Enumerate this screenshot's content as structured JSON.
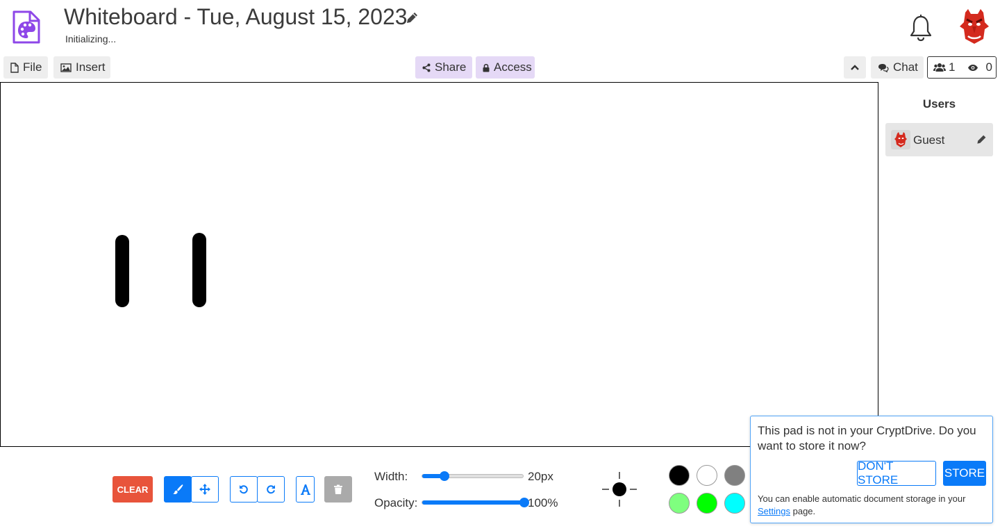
{
  "header": {
    "title": "Whiteboard - Tue, August 15, 2023",
    "status": "Initializing..."
  },
  "toolbar": {
    "file_label": "File",
    "insert_label": "Insert",
    "share_label": "Share",
    "access_label": "Access",
    "chat_label": "Chat",
    "users_count": "1",
    "viewers_count": "0"
  },
  "users_panel": {
    "heading": "Users",
    "users": [
      {
        "name": "Guest"
      }
    ]
  },
  "tools": {
    "clear_label": "CLEAR",
    "width_label": "Width:",
    "width_value": "20px",
    "width_fraction": 0.22,
    "opacity_label": "Opacity:",
    "opacity_value": "100%",
    "opacity_fraction": 1.0,
    "brush_color": "#000000"
  },
  "palette": [
    "#000000",
    "#ffffff",
    "#808080",
    "#f0eee9",
    "#f7e9e9",
    "#f7f0f0",
    "#f8f3e6",
    "#7fff7f",
    "#00ff00",
    "#00ffff"
  ],
  "colors": {
    "accent": "#0a7af8",
    "clear": "#e8543b",
    "share_bg": "#e5d9f6",
    "app_icon": "#8e47e8"
  },
  "store_popup": {
    "question": "This pad is not in your CryptDrive. Do you want to store it now?",
    "dont_store_label": "DON'T STORE",
    "store_label": "STORE",
    "note_before": "You can enable automatic document storage in your",
    "settings_link": "Settings",
    "note_after": "page."
  }
}
